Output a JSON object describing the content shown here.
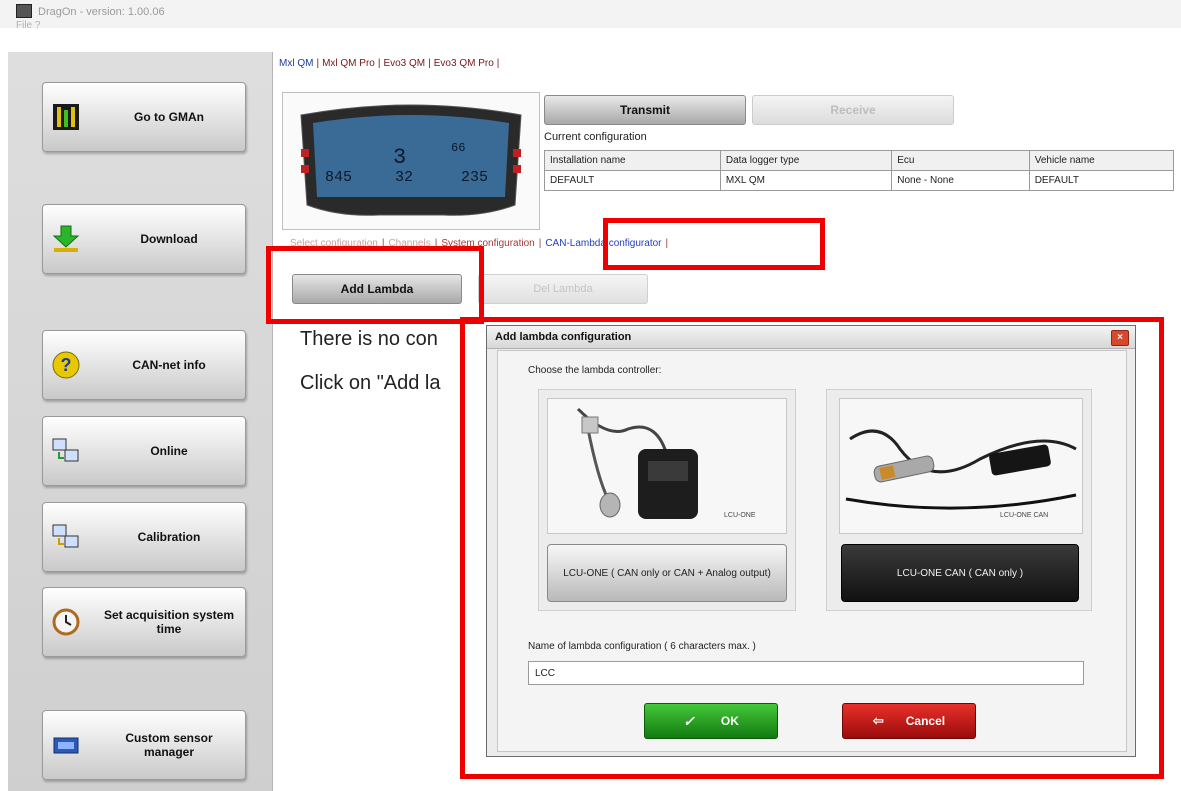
{
  "window": {
    "title": "DragOn  -  version: 1.00.06",
    "menu": "File  ?"
  },
  "sidebar": {
    "buttons": [
      {
        "label": "Go to GMAn",
        "icon": "gman-icon"
      },
      {
        "label": "Download",
        "icon": "download-icon"
      },
      {
        "label": "CAN-net info",
        "icon": "question-icon"
      },
      {
        "label": "Online",
        "icon": "online-icon"
      },
      {
        "label": "Calibration",
        "icon": "calibration-icon"
      },
      {
        "label": "Set acquisition system time",
        "icon": "clock-icon"
      },
      {
        "label": "Custom sensor manager",
        "icon": "sensor-manager-icon"
      }
    ]
  },
  "device_tabs": [
    "Mxl QM",
    "Mxl QM Pro",
    "Evo3 QM",
    "Evo3 QM Pro"
  ],
  "device_tab_selected": "Mxl QM",
  "dash": {
    "readout_left": "845",
    "readout_mid": "32",
    "readout_right": "235",
    "gear": "3",
    "speed": "66"
  },
  "toolbar": {
    "transmit": "Transmit",
    "receive": "Receive"
  },
  "current_configuration": {
    "label": "Current configuration",
    "headers": [
      "Installation name",
      "Data logger type",
      "Ecu",
      "Vehicle name"
    ],
    "row": [
      "DEFAULT",
      "MXL QM",
      "None - None",
      "DEFAULT"
    ]
  },
  "config_tabs": [
    "Select configuration",
    "Channels",
    "System configuration",
    "CAN-Lambda configurator"
  ],
  "config_tab_selected": "CAN-Lambda configurator",
  "lambda_buttons": {
    "add": "Add Lambda",
    "delete": "Del Lambda"
  },
  "message": {
    "line1": "There is no con",
    "line2": "Click on \"Add la"
  },
  "dialog": {
    "title": "Add lambda configuration",
    "choose_label": "Choose the lambda controller:",
    "option1": {
      "photo_caption": "LCU-ONE",
      "button": "LCU-ONE   ( CAN only  or  CAN + Analog output)"
    },
    "option2": {
      "photo_caption": "LCU-ONE  CAN",
      "button": "LCU-ONE CAN   ( CAN only )"
    },
    "name_label": "Name of lambda configuration ( 6 characters max. )",
    "name_value": "LCC",
    "ok": "OK",
    "cancel": "Cancel"
  },
  "colors": {
    "highlight": "#ee0000",
    "ok": "#1f9a18",
    "cancel": "#c81010",
    "selected_tab": "#1f3fbf"
  }
}
